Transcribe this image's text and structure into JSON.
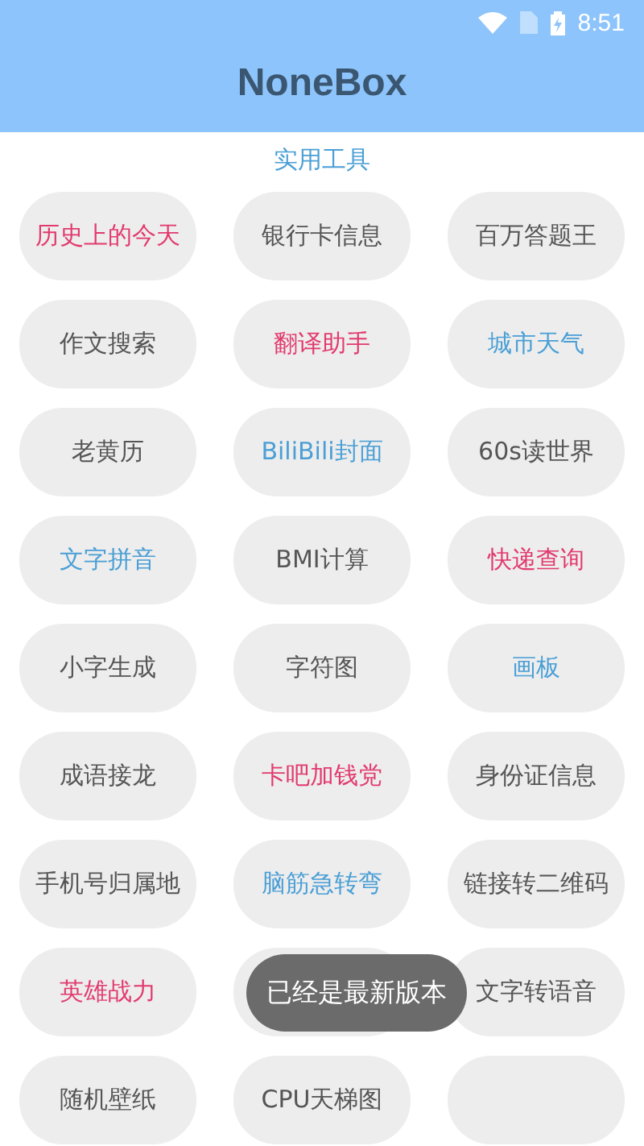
{
  "status_bar": {
    "time": "8:51"
  },
  "app_bar": {
    "title": "NoneBox"
  },
  "section": {
    "title": "实用工具"
  },
  "tools": [
    {
      "label": "历史上的今天",
      "color": "#e23a6e"
    },
    {
      "label": "银行卡信息",
      "color": "#555555"
    },
    {
      "label": "百万答题王",
      "color": "#555555"
    },
    {
      "label": "作文搜索",
      "color": "#555555"
    },
    {
      "label": "翻译助手",
      "color": "#e23a6e"
    },
    {
      "label": "城市天气",
      "color": "#4a9fd6"
    },
    {
      "label": "老黄历",
      "color": "#555555"
    },
    {
      "label": "BiliBili封面",
      "color": "#4a9fd6"
    },
    {
      "label": "60s读世界",
      "color": "#555555"
    },
    {
      "label": "文字拼音",
      "color": "#4a9fd6"
    },
    {
      "label": "BMI计算",
      "color": "#555555"
    },
    {
      "label": "快递查询",
      "color": "#e23a6e"
    },
    {
      "label": "小字生成",
      "color": "#555555"
    },
    {
      "label": "字符图",
      "color": "#555555"
    },
    {
      "label": "画板",
      "color": "#4a9fd6"
    },
    {
      "label": "成语接龙",
      "color": "#555555"
    },
    {
      "label": "卡吧加钱党",
      "color": "#e23a6e"
    },
    {
      "label": "身份证信息",
      "color": "#555555"
    },
    {
      "label": "手机号归属地",
      "color": "#555555"
    },
    {
      "label": "脑筋急转弯",
      "color": "#4a9fd6"
    },
    {
      "label": "链接转二维码",
      "color": "#555555"
    },
    {
      "label": "英雄战力",
      "color": "#e23a6e"
    },
    {
      "kind": "blank"
    },
    {
      "label": "文字转语音",
      "color": "#555555"
    },
    {
      "label": "随机壁纸",
      "color": "#555555"
    },
    {
      "label": "CPU天梯图",
      "color": "#555555"
    },
    {
      "kind": "blank"
    }
  ],
  "toast": {
    "text": "已经是最新版本"
  }
}
